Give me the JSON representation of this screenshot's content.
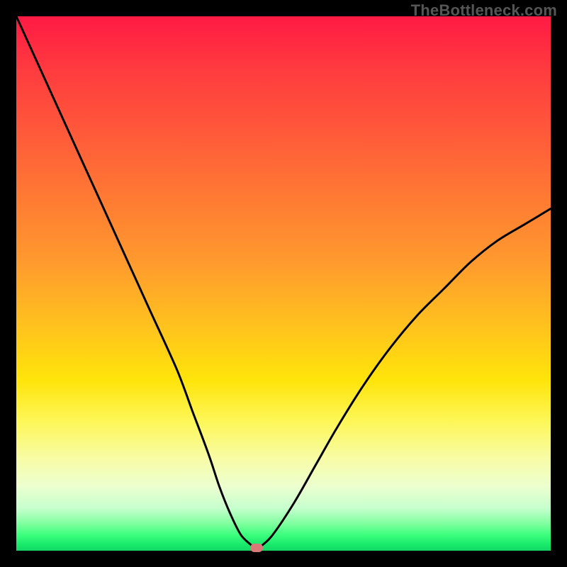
{
  "watermark": "TheBottleneck.com",
  "chart_data": {
    "type": "line",
    "title": "",
    "xlabel": "",
    "ylabel": "",
    "xlim": [
      0,
      100
    ],
    "ylim": [
      0,
      100
    ],
    "grid": false,
    "series": [
      {
        "name": "bottleneck-curve",
        "x": [
          0,
          5,
          10,
          15,
          20,
          25,
          30,
          33,
          36,
          38,
          40,
          42,
          44,
          45,
          46,
          48,
          52,
          56,
          60,
          65,
          70,
          75,
          80,
          85,
          90,
          95,
          100
        ],
        "y": [
          100,
          89,
          78,
          67,
          56,
          45,
          34,
          26,
          18,
          12,
          7,
          3,
          1,
          0,
          1,
          3,
          9,
          16,
          23,
          31,
          38,
          44,
          49,
          54,
          58,
          61,
          64
        ]
      }
    ],
    "marker": {
      "x": 45,
      "y": 0
    },
    "background_gradient": {
      "top": "#ff1a44",
      "mid": "#ffe40a",
      "bottom": "#14d765"
    }
  }
}
